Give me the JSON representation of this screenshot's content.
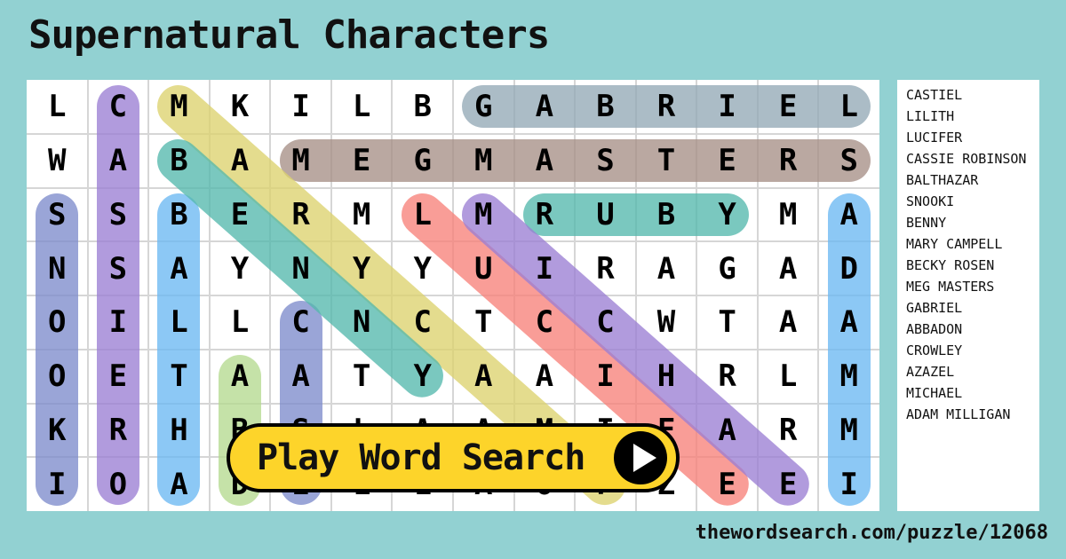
{
  "title": "Supernatural Characters",
  "grid": [
    [
      "L",
      "C",
      "M",
      "K",
      "I",
      "L",
      "B",
      "G",
      "A",
      "B",
      "R",
      "I",
      "E",
      "L"
    ],
    [
      "W",
      "A",
      "B",
      "A",
      "M",
      "E",
      "G",
      "M",
      "A",
      "S",
      "T",
      "E",
      "R",
      "S"
    ],
    [
      "S",
      "S",
      "B",
      "E",
      "R",
      "M",
      "L",
      "M",
      "R",
      "U",
      "B",
      "Y",
      "M",
      "A"
    ],
    [
      "N",
      "S",
      "A",
      "Y",
      "N",
      "Y",
      "Y",
      "U",
      "I",
      "R",
      "A",
      "G",
      "A",
      "D"
    ],
    [
      "O",
      "I",
      "L",
      "L",
      "C",
      "N",
      "C",
      "T",
      "C",
      "C",
      "W",
      "T",
      "A",
      "A"
    ],
    [
      "O",
      "E",
      "T",
      "A",
      "A",
      "T",
      "Y",
      "A",
      "A",
      "I",
      "H",
      "R",
      "L",
      "M"
    ],
    [
      "K",
      "R",
      "H",
      "B",
      "S",
      "L",
      "A",
      "A",
      "M",
      "I",
      "F",
      "A",
      "R",
      "M"
    ],
    [
      "I",
      "O",
      "A",
      "D",
      "E",
      "L",
      "L",
      "A",
      "O",
      "P",
      "Z",
      "E",
      "E",
      "I"
    ]
  ],
  "highlights": [
    {
      "word": "CASSIE ROBINSON",
      "start": [
        0,
        1
      ],
      "end": [
        7,
        1
      ],
      "color": "#9b7fd4"
    },
    {
      "word": "SNOOKI",
      "start": [
        2,
        0
      ],
      "end": [
        7,
        0
      ],
      "color": "#7d8ccc"
    },
    {
      "word": "BALTHAZAR",
      "start": [
        2,
        2
      ],
      "end": [
        7,
        2
      ],
      "color": "#6bb8f2"
    },
    {
      "word": "ABBADON",
      "start": [
        5,
        3
      ],
      "end": [
        7,
        3
      ],
      "color": "#b5da8f"
    },
    {
      "word": "CROWLEY",
      "start": [
        4,
        4
      ],
      "end": [
        7,
        4
      ],
      "color": "#7d8ccc"
    },
    {
      "word": "ADAM MILLIGAN",
      "start": [
        2,
        13
      ],
      "end": [
        7,
        13
      ],
      "color": "#6bb8f2"
    },
    {
      "word": "GABRIEL",
      "start": [
        0,
        7
      ],
      "end": [
        0,
        13
      ],
      "color": "#93a9b6"
    },
    {
      "word": "MEG MASTERS",
      "start": [
        1,
        4
      ],
      "end": [
        1,
        13
      ],
      "color": "#a68f86"
    },
    {
      "word": "RUBY",
      "start": [
        2,
        8
      ],
      "end": [
        2,
        11
      ],
      "color": "#54b9ad"
    },
    {
      "word": "MARY CAMPELL",
      "start": [
        0,
        2
      ],
      "end": [
        7,
        9
      ],
      "color": "#dcd26e"
    },
    {
      "word": "BENNY",
      "start": [
        1,
        2
      ],
      "end": [
        5,
        6
      ],
      "color": "#54b9ad"
    },
    {
      "word": "LUCIFER",
      "start": [
        2,
        6
      ],
      "end": [
        7,
        11
      ],
      "color": "#f7817a"
    },
    {
      "word": "MICHAEL",
      "start": [
        2,
        7
      ],
      "end": [
        7,
        12
      ],
      "color": "#9b7fd4"
    }
  ],
  "words": [
    "CASTIEL",
    "LILITH",
    "LUCIFER",
    "CASSIE ROBINSON",
    "BALTHAZAR",
    "SNOOKI",
    "BENNY",
    "MARY CAMPELL",
    "BECKY ROSEN",
    "MEG MASTERS",
    "GABRIEL",
    "ABBADON",
    "CROWLEY",
    "AZAZEL",
    "MICHAEL",
    "ADAM MILLIGAN"
  ],
  "play_button": {
    "label": "Play Word Search",
    "icon": "play-icon"
  },
  "footer": "thewordsearch.com/puzzle/12068"
}
